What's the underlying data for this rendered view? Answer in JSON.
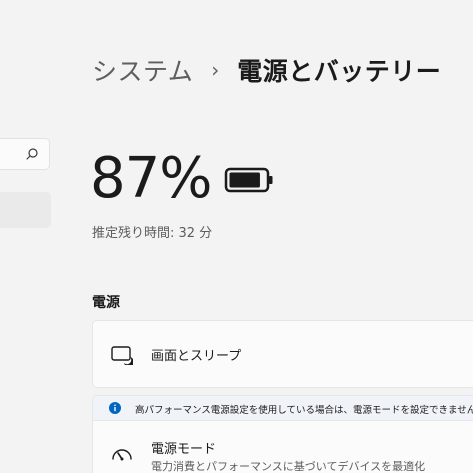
{
  "breadcrumb": {
    "parent": "システム",
    "separator": "›",
    "current": "電源とバッテリー"
  },
  "battery": {
    "percent_label": "87%",
    "level": 0.87,
    "remaining_label": "推定残り時間: 32 分"
  },
  "power_section": {
    "title": "電源",
    "screen_sleep": {
      "label": "画面とスリープ",
      "icon": "screen-sleep-icon"
    },
    "info_bar": {
      "text": "高パフォーマンス電源設定を使用している場合は、電源モードを設定できません。",
      "icon": "info-icon"
    },
    "power_mode": {
      "label": "電源モード",
      "description": "電力消費とパフォーマンスに基づいてデバイスを最適化",
      "icon": "gauge-icon"
    }
  },
  "search": {
    "icon": "search-icon"
  },
  "colors": {
    "background": "#f3f3f3",
    "card": "#fbfbfb",
    "accent": "#0067c0",
    "info_bar": "#f0f4f9"
  }
}
